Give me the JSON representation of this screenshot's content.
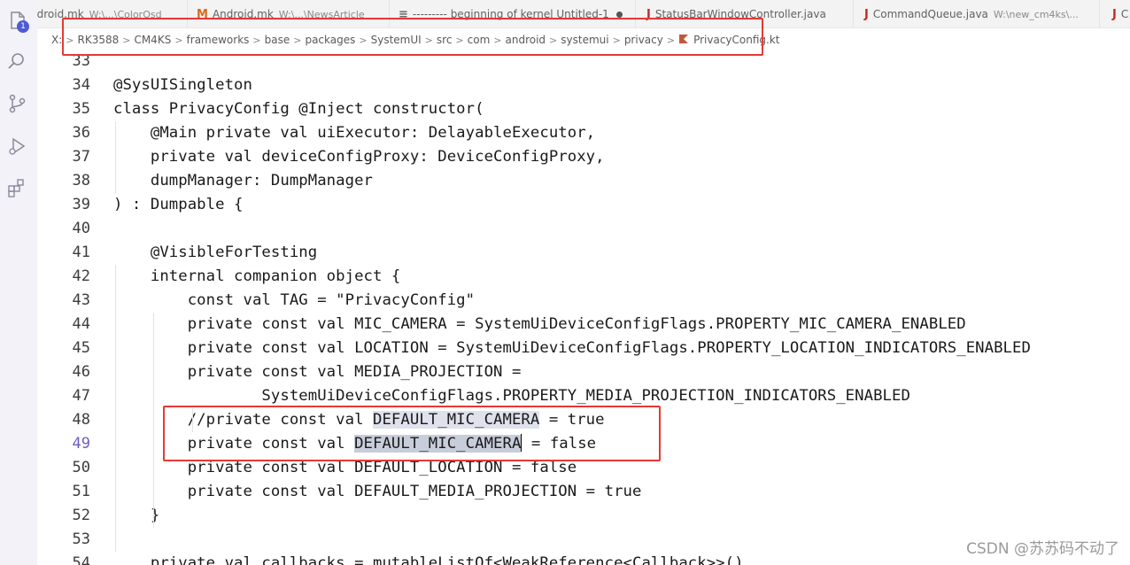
{
  "activity_bar": {
    "explorer_badge": "1",
    "items": [
      "explorer-icon",
      "search-icon",
      "source-control-icon",
      "run-debug-icon",
      "extensions-icon"
    ]
  },
  "tabs": [
    {
      "icon": "",
      "label": "ndroid.mk",
      "desc": "W:\\...\\ColorOsd",
      "icon_color": "#444444"
    },
    {
      "icon": "M",
      "label": "Android.mk",
      "desc": "W:\\...\\NewsArticle",
      "icon_color": "#d86a1f"
    },
    {
      "icon": "≡",
      "label": "--------- beginning of kernel  Untitled-1",
      "desc": "",
      "icon_color": "#666666"
    },
    {
      "icon": "J",
      "label": "StatusBarWindowController.java",
      "desc": "",
      "icon_color": "#c62828"
    },
    {
      "icon": "J",
      "label": "CommandQueue.java",
      "desc": "W:\\new_cm4ks\\...",
      "icon_color": "#c62828"
    },
    {
      "icon": "J",
      "label": "C",
      "desc": "",
      "icon_color": "#c62828"
    }
  ],
  "breadcrumb": [
    "X:",
    "RK3588",
    "CM4KS",
    "frameworks",
    "base",
    "packages",
    "SystemUI",
    "src",
    "com",
    "android",
    "systemui",
    "privacy",
    "PrivacyConfig.kt"
  ],
  "code_lines": [
    {
      "n": "33",
      "t": ""
    },
    {
      "n": "34",
      "t": "@SysUISingleton"
    },
    {
      "n": "35",
      "t": "class PrivacyConfig @Inject constructor("
    },
    {
      "n": "36",
      "t": "    @Main private val uiExecutor: DelayableExecutor,"
    },
    {
      "n": "37",
      "t": "    private val deviceConfigProxy: DeviceConfigProxy,"
    },
    {
      "n": "38",
      "t": "    dumpManager: DumpManager"
    },
    {
      "n": "39",
      "t": ") : Dumpable {"
    },
    {
      "n": "40",
      "t": ""
    },
    {
      "n": "41",
      "t": "    @VisibleForTesting"
    },
    {
      "n": "42",
      "t": "    internal companion object {"
    },
    {
      "n": "43",
      "t": "        const val TAG = \"PrivacyConfig\""
    },
    {
      "n": "44",
      "t": "        private const val MIC_CAMERA = SystemUiDeviceConfigFlags.PROPERTY_MIC_CAMERA_ENABLED"
    },
    {
      "n": "45",
      "t": "        private const val LOCATION = SystemUiDeviceConfigFlags.PROPERTY_LOCATION_INDICATORS_ENABLED"
    },
    {
      "n": "46",
      "t": "        private const val MEDIA_PROJECTION ="
    },
    {
      "n": "47",
      "t": "                SystemUiDeviceConfigFlags.PROPERTY_MEDIA_PROJECTION_INDICATORS_ENABLED"
    },
    {
      "n": "48",
      "t": "        //private const val DEFAULT_MIC_CAMERA = true"
    },
    {
      "n": "49",
      "t": "        private const val DEFAULT_MIC_CAMERA = false"
    },
    {
      "n": "50",
      "t": "        private const val DEFAULT_LOCATION = false"
    },
    {
      "n": "51",
      "t": "        private const val DEFAULT_MEDIA_PROJECTION = true"
    },
    {
      "n": "52",
      "t": "    }"
    },
    {
      "n": "53",
      "t": ""
    },
    {
      "n": "54",
      "t": "    private val callbacks = mutableListOf<WeakReference<Callback>>()"
    }
  ],
  "active_line": "49",
  "highlight_word": "DEFAULT_MIC_CAMERA",
  "watermark": "CSDN @苏苏码不动了",
  "colors": {
    "annotation": "#e53935",
    "active_line_number": "#6c5fc7",
    "selection": "#c8cddb"
  }
}
